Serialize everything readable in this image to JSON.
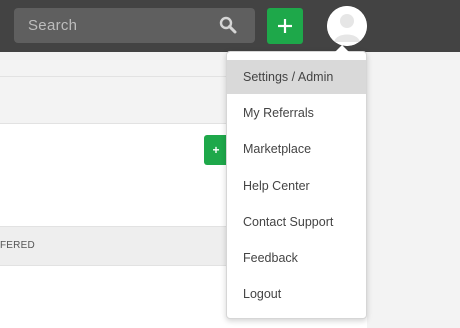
{
  "search": {
    "placeholder": "Search",
    "icon": "search-icon"
  },
  "header": {
    "add_label": "+"
  },
  "page": {
    "small_button_label": "+",
    "column_fragment": "FERED"
  },
  "menu": {
    "items": [
      {
        "label": "Settings / Admin",
        "active": true
      },
      {
        "label": "My Referrals",
        "active": false
      },
      {
        "label": "Marketplace",
        "active": false
      },
      {
        "label": "Help Center",
        "active": false
      },
      {
        "label": "Contact Support",
        "active": false
      },
      {
        "label": "Feedback",
        "active": false
      },
      {
        "label": "Logout",
        "active": false
      }
    ]
  },
  "colors": {
    "topbar": "#434343",
    "accent_green": "#1ea84a",
    "menu_active": "#d9d9d9"
  }
}
